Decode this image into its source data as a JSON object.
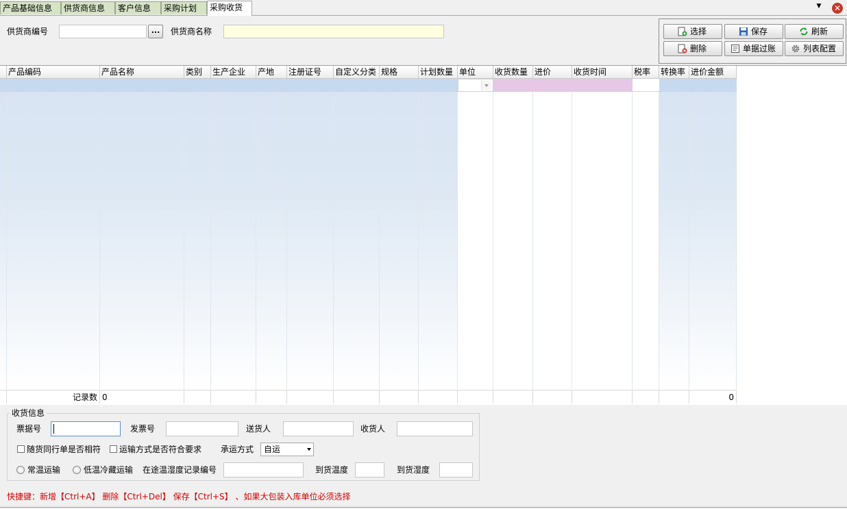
{
  "tabs": [
    "产品基础信息",
    "供货商信息",
    "客户信息",
    "采购计划",
    "采购收货"
  ],
  "header": {
    "supplier_code_label": "供货商编号",
    "supplier_code_value": "",
    "browse_label": "...",
    "supplier_name_label": "供货商名称",
    "supplier_name_value": ""
  },
  "toolbar": {
    "select": "选择",
    "save": "保存",
    "refresh": "刷新",
    "delete": "删除",
    "post": "单据过账",
    "config": "列表配置"
  },
  "grid": {
    "columns": [
      "产品编码",
      "产品名称",
      "类别",
      "生产企业",
      "产地",
      "注册证号",
      "自定义分类",
      "规格",
      "计划数量",
      "单位",
      "收货数量",
      "进价",
      "收货时间",
      "税率",
      "转换率",
      "进价金额"
    ],
    "footer_label": "记录数",
    "record_count": "0",
    "amount_total": "0"
  },
  "receive": {
    "title": "收货信息",
    "ticket_no_label": "票据号",
    "invoice_no_label": "发票号",
    "deliverer_label": "送货人",
    "receiver_label": "收货人",
    "check_match_label": "随货同行单是否相符",
    "check_transport_label": "运输方式是否符合要求",
    "carrier_label": "承运方式",
    "carrier_value": "自运",
    "radio_normal_label": "常温运输",
    "radio_cold_label": "低温冷藏运输",
    "temp_record_label": "在途温湿度记录编号",
    "arrival_temp_label": "到货温度",
    "arrival_humidity_label": "到货湿度"
  },
  "shortcut_text": "快捷键：新增【Ctrl+A】 删除【Ctrl+Del】 保存【Ctrl+S】 、如果大包装入库单位必须选择"
}
